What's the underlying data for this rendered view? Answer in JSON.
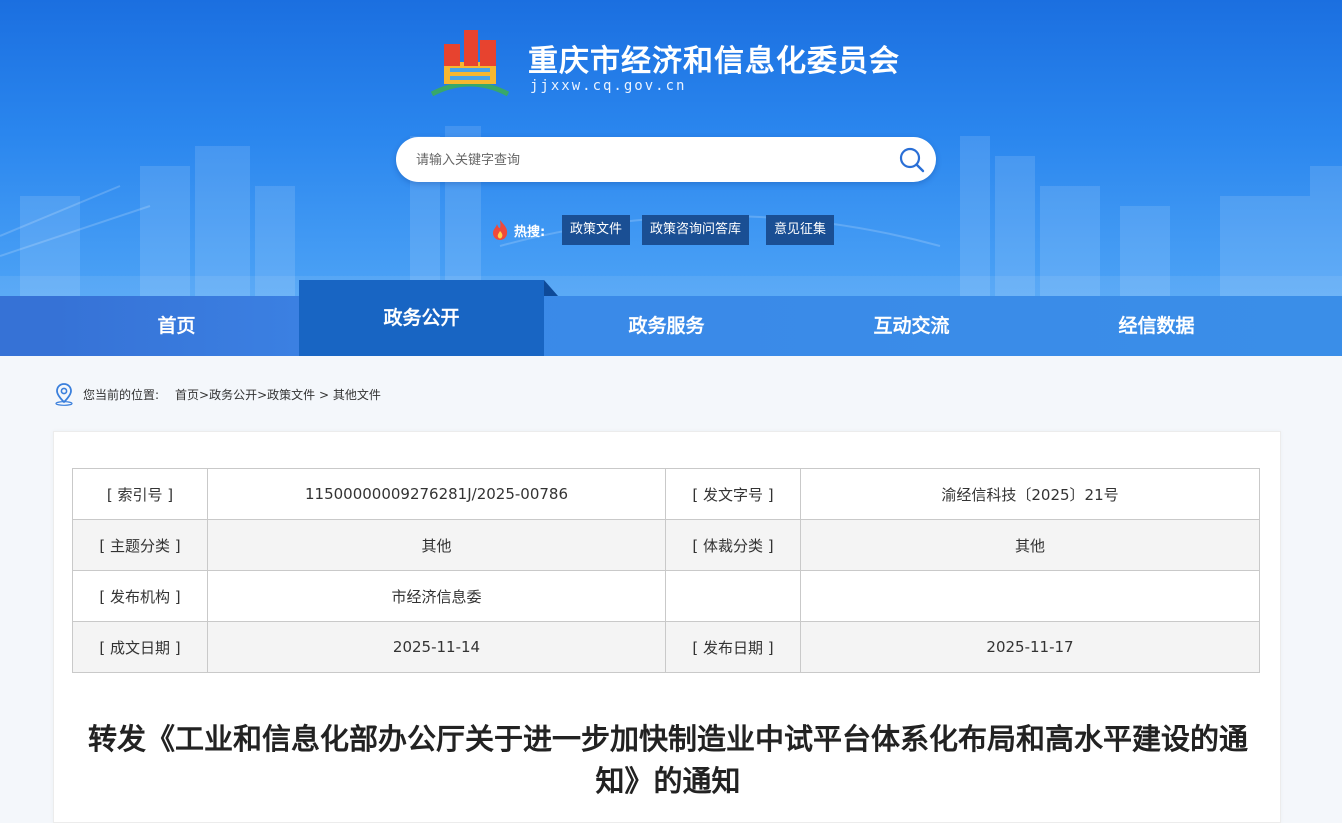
{
  "header": {
    "site_title": "重庆市经济和信息化委员会",
    "site_domain": "jjxxw.cq.gov.cn",
    "search_placeholder": "请输入关键字查询",
    "hot_label": "热搜:",
    "hot_tags": [
      "政策文件",
      "政策咨询问答库",
      "意见征集"
    ]
  },
  "nav": {
    "items": [
      "首页",
      "政务公开",
      "政务服务",
      "互动交流",
      "经信数据"
    ],
    "active_index": 1
  },
  "breadcrumb": {
    "label": "您当前的位置:",
    "path": [
      "首页",
      "政务公开",
      "政策文件",
      "其他文件"
    ]
  },
  "meta": {
    "rows": [
      {
        "k1": "[ 索引号 ]",
        "v1": "11500000009276281J/2025-00786",
        "k2": "[ 发文字号 ]",
        "v2": "渝经信科技〔2025〕21号"
      },
      {
        "k1": "[ 主题分类 ]",
        "v1": "其他",
        "k2": "[ 体裁分类 ]",
        "v2": "其他"
      },
      {
        "k1": "[ 发布机构 ]",
        "v1": "市经济信息委",
        "k2": "",
        "v2": ""
      },
      {
        "k1": "[ 成文日期 ]",
        "v1": "2025-11-14",
        "k2": "[ 发布日期 ]",
        "v2": "2025-11-17"
      }
    ]
  },
  "document": {
    "title": "转发《工业和信息化部办公厅关于进一步加快制造业中试平台体系化布局和高水平建设的通知》的通知"
  },
  "colors": {
    "banner_top": "#1b6fe0",
    "nav_bg": "#3a8ae8",
    "nav_active": "#1865c3",
    "tag_bg": "#1a4f94"
  },
  "icons": [
    "logo-mark-icon",
    "search-icon",
    "fire-icon",
    "location-pin-icon"
  ]
}
